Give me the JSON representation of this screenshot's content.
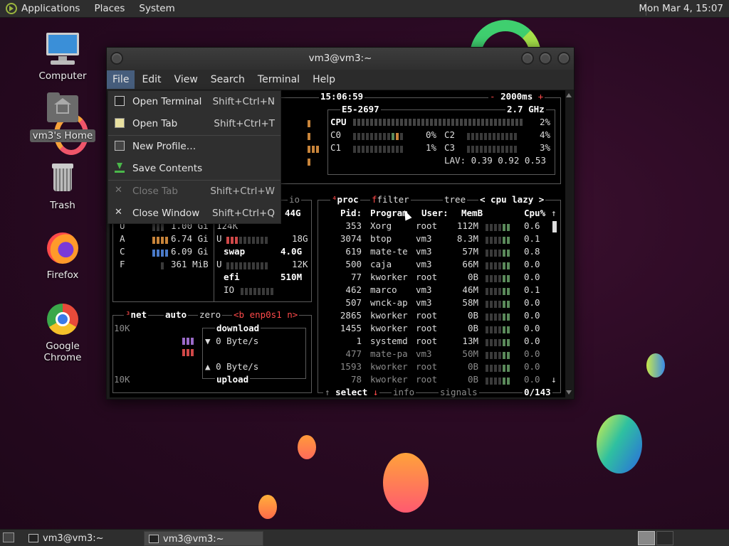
{
  "top_panel": {
    "menus": [
      "Applications",
      "Places",
      "System"
    ],
    "clock": "Mon Mar  4, 15:07"
  },
  "desktop_icons": [
    {
      "label": "Computer"
    },
    {
      "label": "vm3's Home"
    },
    {
      "label": "Trash"
    },
    {
      "label": "Firefox"
    },
    {
      "label": "Google Chrome"
    }
  ],
  "window": {
    "title": "vm3@vm3:~",
    "menubar": [
      "File",
      "Edit",
      "View",
      "Search",
      "Terminal",
      "Help"
    ]
  },
  "file_menu": {
    "items": [
      {
        "label": "Open Terminal",
        "shortcut": "Shift+Ctrl+N",
        "icon": "terminal-icon",
        "enabled": true
      },
      {
        "label": "Open Tab",
        "shortcut": "Shift+Ctrl+T",
        "icon": "tab-icon",
        "enabled": true
      },
      {
        "label": "New Profile…",
        "shortcut": "",
        "icon": "profile-icon",
        "enabled": true
      },
      {
        "label": "Save Contents",
        "shortcut": "",
        "icon": "save-icon",
        "enabled": true
      },
      {
        "label": "Close Tab",
        "shortcut": "Shift+Ctrl+W",
        "icon": "close-icon",
        "enabled": false
      },
      {
        "label": "Close Window",
        "shortcut": "Shift+Ctrl+Q",
        "icon": "close-icon",
        "enabled": true
      }
    ]
  },
  "btop": {
    "clock": "15:06:59",
    "refresh": "2000ms",
    "cpu_model": "E5-2697",
    "cpu_freq": "2.7 GHz",
    "cpu_total": {
      "label": "CPU",
      "pct": "2%"
    },
    "cores": [
      {
        "label": "C0",
        "pct": "0%"
      },
      {
        "label": "C1",
        "pct": "1%"
      },
      {
        "label": "C2",
        "pct": "4%"
      },
      {
        "label": "C3",
        "pct": "3%"
      }
    ],
    "lav": "LAV: 0.39 0.92 0.53",
    "mem": {
      "io_label": "io",
      "rows": [
        {
          "k": "U",
          "v": "1.00 Gi"
        },
        {
          "k": "A",
          "v": "6.74 Gi"
        },
        {
          "k": "C",
          "v": "6.09 Gi"
        },
        {
          "k": "F",
          "v": "361 MiB"
        }
      ]
    },
    "disks": {
      "top_total": "44G",
      "root_used": "124K",
      "u1": "U",
      "u1_val": "18G",
      "swap": "swap",
      "swap_val": "4.0G",
      "u2": "U",
      "u2_val": "12K",
      "efi": "efi",
      "efi_val": "510M",
      "io": "IO"
    },
    "net": {
      "header": "net",
      "auto": "auto",
      "zero": "zero",
      "iface": "<b enp0s1 n>",
      "scale_top": "10K",
      "scale_bottom": "10K",
      "download": "download",
      "down_rate": "0 Byte/s",
      "upload": "upload",
      "up_rate": "0 Byte/s"
    },
    "proc": {
      "header": "proc",
      "filter": "filter",
      "tree": "tree",
      "sort": "< cpu lazy >",
      "columns": {
        "pid": "Pid:",
        "program": "Program",
        "user": "User:",
        "mem": "MemB",
        "cpu": "Cpu%"
      },
      "rows": [
        {
          "pid": "353",
          "program": "Xorg",
          "user": "root",
          "mem": "112M",
          "cpu": "0.6"
        },
        {
          "pid": "3074",
          "program": "btop",
          "user": "vm3",
          "mem": "8.3M",
          "cpu": "0.1"
        },
        {
          "pid": "619",
          "program": "mate-te",
          "user": "vm3",
          "mem": "57M",
          "cpu": "0.8"
        },
        {
          "pid": "500",
          "program": "caja",
          "user": "vm3",
          "mem": "66M",
          "cpu": "0.0"
        },
        {
          "pid": "77",
          "program": "kworker",
          "user": "root",
          "mem": "0B",
          "cpu": "0.0"
        },
        {
          "pid": "462",
          "program": "marco",
          "user": "vm3",
          "mem": "46M",
          "cpu": "0.1"
        },
        {
          "pid": "507",
          "program": "wnck-ap",
          "user": "vm3",
          "mem": "58M",
          "cpu": "0.0"
        },
        {
          "pid": "2865",
          "program": "kworker",
          "user": "root",
          "mem": "0B",
          "cpu": "0.0"
        },
        {
          "pid": "1455",
          "program": "kworker",
          "user": "root",
          "mem": "0B",
          "cpu": "0.0"
        },
        {
          "pid": "1",
          "program": "systemd",
          "user": "root",
          "mem": "13M",
          "cpu": "0.0"
        },
        {
          "pid": "477",
          "program": "mate-pa",
          "user": "vm3",
          "mem": "50M",
          "cpu": "0.0"
        },
        {
          "pid": "1593",
          "program": "kworker",
          "user": "root",
          "mem": "0B",
          "cpu": "0.0"
        },
        {
          "pid": "78",
          "program": "kworker",
          "user": "root",
          "mem": "0B",
          "cpu": "0.0"
        }
      ],
      "footer": {
        "select": "select",
        "info": "info",
        "signals": "signals",
        "count": "0/143"
      }
    }
  },
  "taskbar": {
    "items": [
      {
        "label": "vm3@vm3:~",
        "active": false
      },
      {
        "label": "vm3@vm3:~",
        "active": true
      }
    ]
  }
}
